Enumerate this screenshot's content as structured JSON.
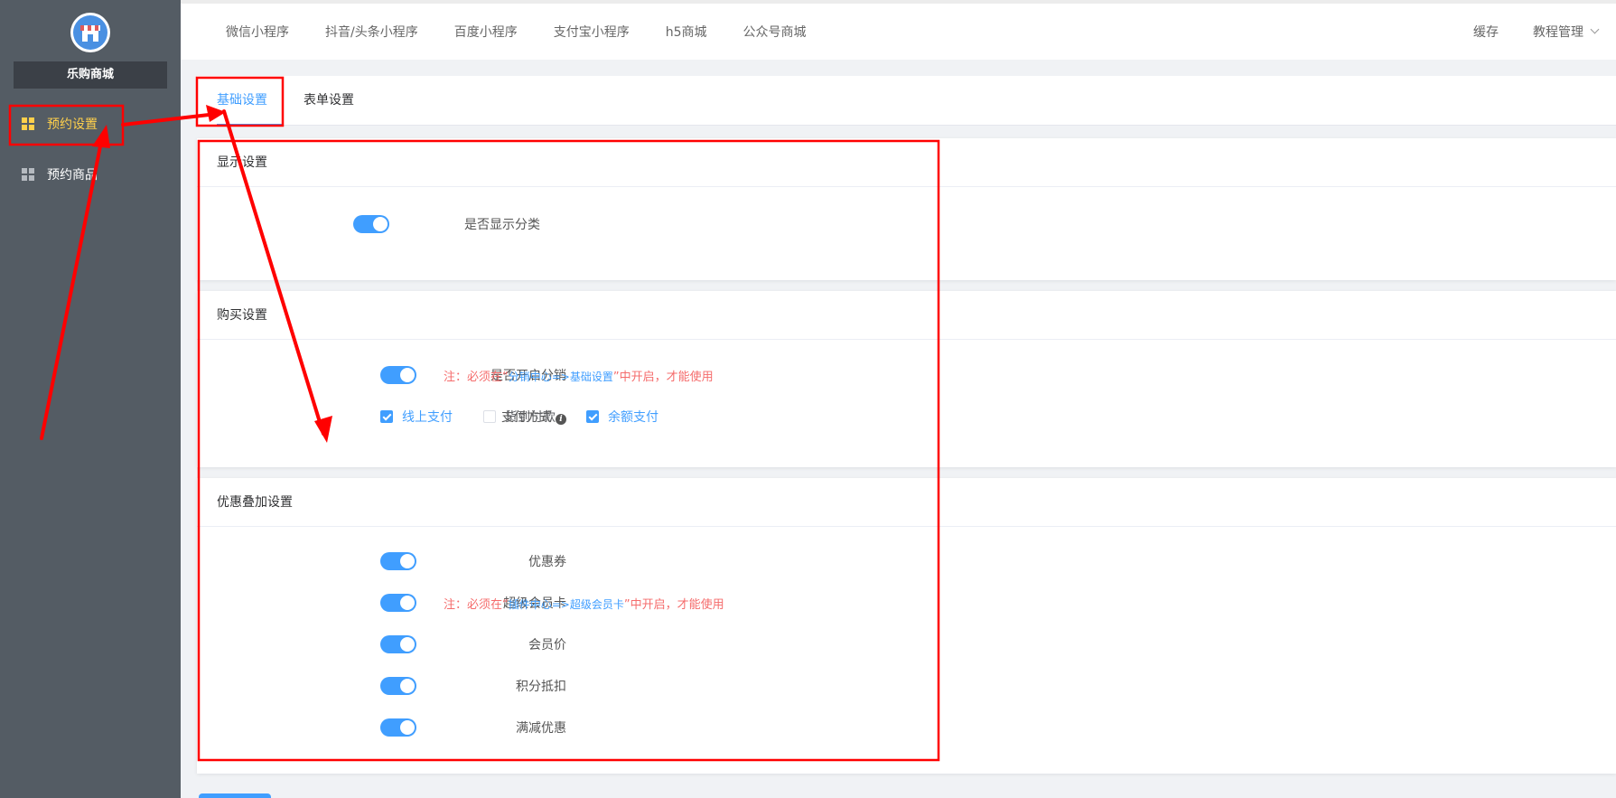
{
  "sidebar": {
    "shop_name": "乐购商城",
    "items": [
      {
        "label": "预约设置",
        "icon": "grid-icon",
        "active": true
      },
      {
        "label": "预约商品",
        "icon": "grid-icon",
        "active": false
      }
    ]
  },
  "topnav": {
    "items": [
      "微信小程序",
      "抖音/头条小程序",
      "百度小程序",
      "支付宝小程序",
      "h5商城",
      "公众号商城"
    ],
    "right": {
      "cache": "缓存",
      "tutorial": "教程管理"
    }
  },
  "tabs": [
    {
      "label": "基础设置",
      "active": true
    },
    {
      "label": "表单设置",
      "active": false
    }
  ],
  "display_section": {
    "title": "显示设置",
    "show_category_label": "是否显示分类",
    "show_category": true
  },
  "purchase_section": {
    "title": "购买设置",
    "distribution_label": "是否开启分销",
    "distribution": true,
    "distribution_note": {
      "prefix": "注：必须在“",
      "link": "分销中心=>基础设置",
      "suffix": "”中开启，才能使用"
    },
    "payment_label": "支付方式",
    "payment_options": [
      {
        "label": "线上支付",
        "checked": true
      },
      {
        "label": "货到付款",
        "checked": false
      },
      {
        "label": "余额支付",
        "checked": true
      }
    ]
  },
  "discount_section": {
    "title": "优惠叠加设置",
    "items": [
      {
        "label": "优惠券",
        "on": true
      },
      {
        "label": "超级会员卡",
        "on": true
      },
      {
        "label": "会员价",
        "on": true
      },
      {
        "label": "积分抵扣",
        "on": true
      },
      {
        "label": "满减优惠",
        "on": true
      }
    ],
    "svip_note": {
      "prefix": "注：必须在“",
      "link": "插件中心=>超级会员卡",
      "suffix": "”中开启，才能使用"
    }
  },
  "colors": {
    "primary": "#409eff",
    "sidebar_bg": "#545c64",
    "active_menu": "#ffd04b",
    "annotation_red": "#ff0000",
    "note_red": "#f56c6c"
  }
}
